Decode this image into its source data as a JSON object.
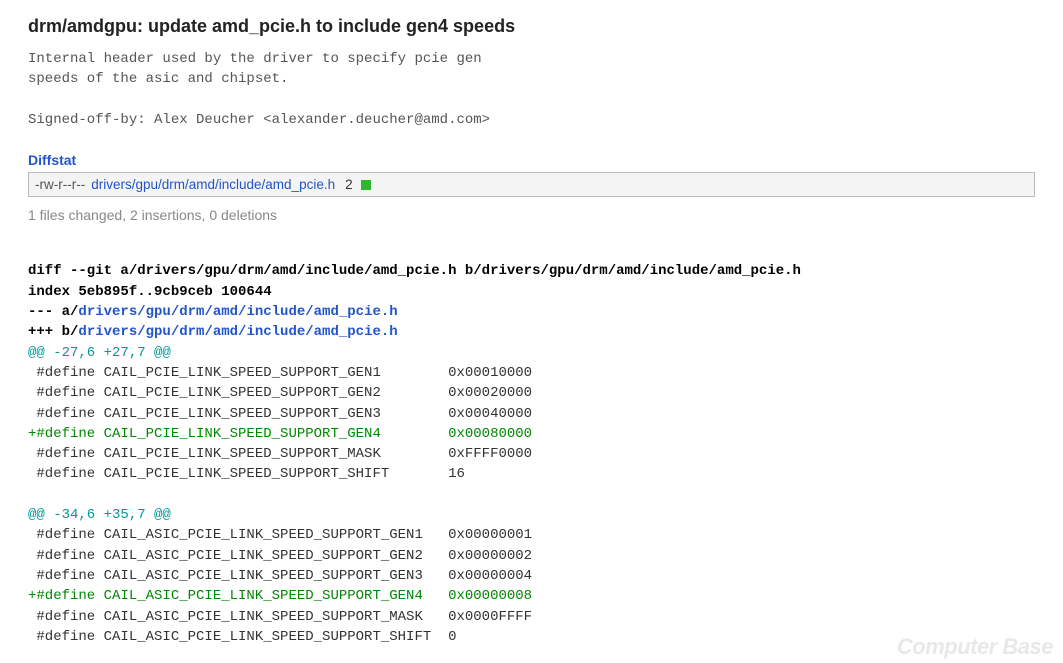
{
  "commit": {
    "title": "drm/amdgpu: update amd_pcie.h to include gen4 speeds",
    "message": "Internal header used by the driver to specify pcie gen\nspeeds of the asic and chipset.\n\nSigned-off-by: Alex Deucher <alexander.deucher@amd.com>"
  },
  "diffstat": {
    "header": "Diffstat",
    "mode": "-rw-r--r--",
    "path": "drivers/gpu/drm/amd/include/amd_pcie.h",
    "changes": "2",
    "summary": "1 files changed, 2 insertions, 0 deletions"
  },
  "diff": {
    "cmd": "diff --git a/drivers/gpu/drm/amd/include/amd_pcie.h b/drivers/gpu/drm/amd/include/amd_pcie.h",
    "index": "index 5eb895f..9cb9ceb 100644",
    "minus_prefix": "--- a/",
    "plus_prefix": "+++ b/",
    "file_a": "drivers/gpu/drm/amd/include/amd_pcie.h",
    "file_b": "drivers/gpu/drm/amd/include/amd_pcie.h",
    "hunks": [
      {
        "header": "@@ -27,6 +27,7 @@",
        "lines": [
          {
            "t": "ctx",
            "text": " #define CAIL_PCIE_LINK_SPEED_SUPPORT_GEN1        0x00010000"
          },
          {
            "t": "ctx",
            "text": " #define CAIL_PCIE_LINK_SPEED_SUPPORT_GEN2        0x00020000"
          },
          {
            "t": "ctx",
            "text": " #define CAIL_PCIE_LINK_SPEED_SUPPORT_GEN3        0x00040000"
          },
          {
            "t": "add",
            "text": "+#define CAIL_PCIE_LINK_SPEED_SUPPORT_GEN4        0x00080000"
          },
          {
            "t": "ctx",
            "text": " #define CAIL_PCIE_LINK_SPEED_SUPPORT_MASK        0xFFFF0000"
          },
          {
            "t": "ctx",
            "text": " #define CAIL_PCIE_LINK_SPEED_SUPPORT_SHIFT       16"
          },
          {
            "t": "ctx",
            "text": ""
          }
        ]
      },
      {
        "header": "@@ -34,6 +35,7 @@",
        "lines": [
          {
            "t": "ctx",
            "text": " #define CAIL_ASIC_PCIE_LINK_SPEED_SUPPORT_GEN1   0x00000001"
          },
          {
            "t": "ctx",
            "text": " #define CAIL_ASIC_PCIE_LINK_SPEED_SUPPORT_GEN2   0x00000002"
          },
          {
            "t": "ctx",
            "text": " #define CAIL_ASIC_PCIE_LINK_SPEED_SUPPORT_GEN3   0x00000004"
          },
          {
            "t": "add",
            "text": "+#define CAIL_ASIC_PCIE_LINK_SPEED_SUPPORT_GEN4   0x00000008"
          },
          {
            "t": "ctx",
            "text": " #define CAIL_ASIC_PCIE_LINK_SPEED_SUPPORT_MASK   0x0000FFFF"
          },
          {
            "t": "ctx",
            "text": " #define CAIL_ASIC_PCIE_LINK_SPEED_SUPPORT_SHIFT  0"
          }
        ]
      }
    ]
  },
  "watermark": "Computer\nBase"
}
